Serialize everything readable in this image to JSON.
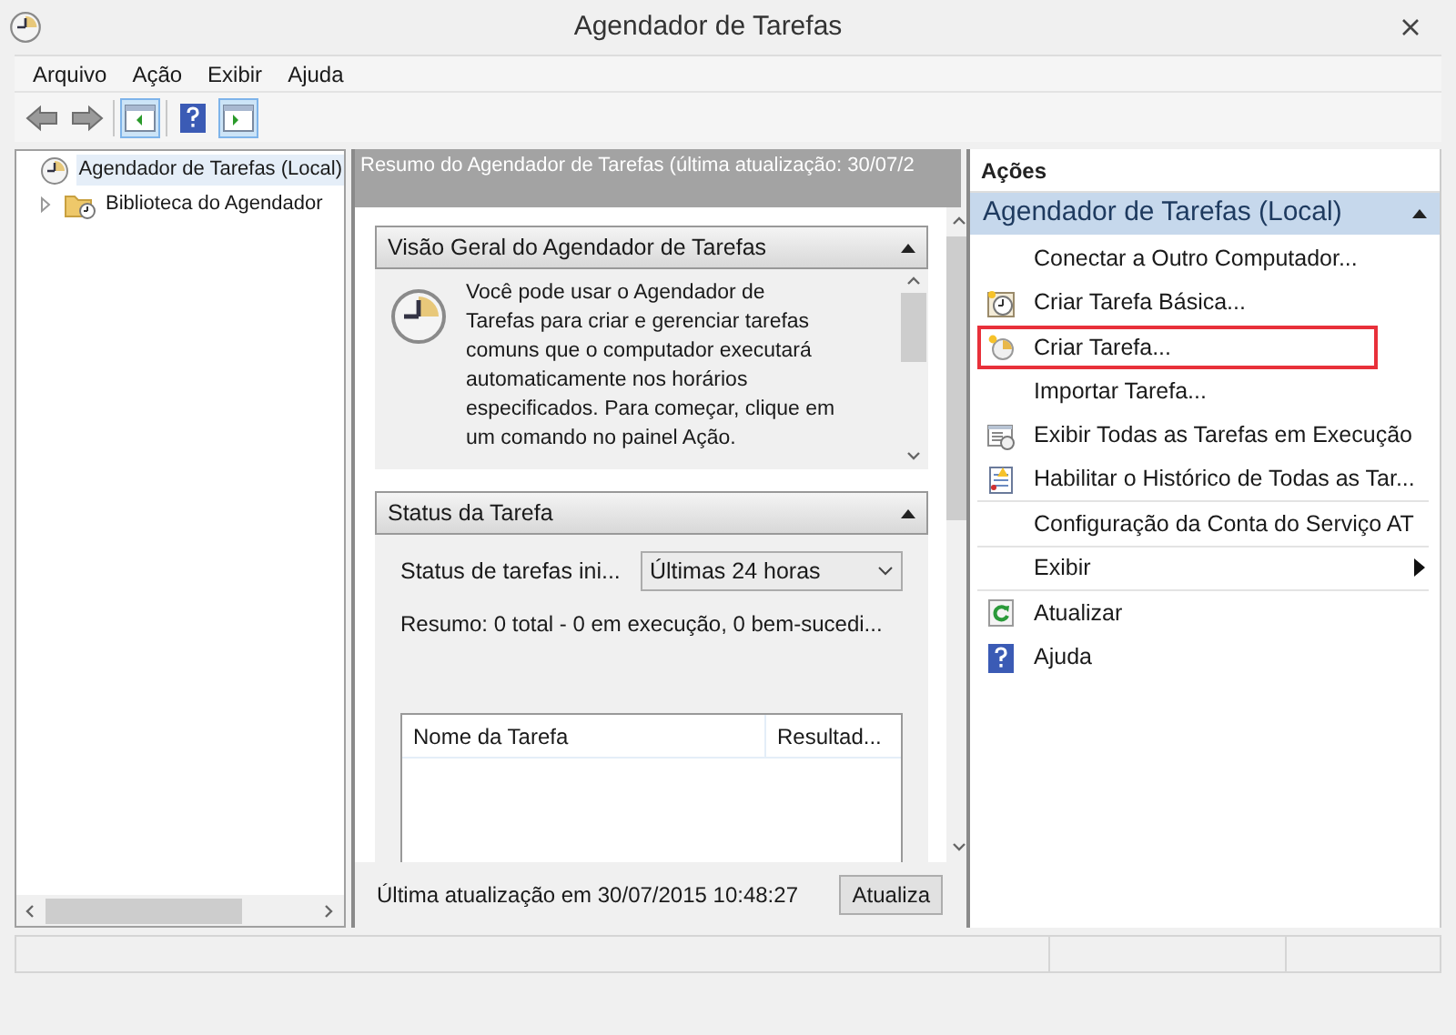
{
  "window": {
    "title": "Agendador de Tarefas"
  },
  "menu": [
    "Arquivo",
    "Ação",
    "Exibir",
    "Ajuda"
  ],
  "toolbar": [
    {
      "kind": "back",
      "selected": false
    },
    {
      "kind": "forward",
      "selected": false
    },
    {
      "kind": "show-tree",
      "selected": true
    },
    {
      "kind": "help",
      "selected": false
    },
    {
      "kind": "show-actions",
      "selected": true
    }
  ],
  "tree": [
    {
      "label": "Agendador de Tarefas (Local)",
      "selected": true,
      "children": [
        {
          "label": "Biblioteca do Agendador",
          "selected": false,
          "expanded": false
        }
      ]
    }
  ],
  "summary": {
    "header": "Resumo do Agendador de Tarefas (última atualização: 30/07/2",
    "overview": {
      "title": "Visão Geral do Agendador de Tarefas",
      "text": "Você pode usar o Agendador de Tarefas para criar e gerenciar tarefas comuns que o computador executará automaticamente nos horários especificados. Para começar, clique em um comando no painel Ação."
    },
    "status": {
      "title": "Status da Tarefa",
      "filter_label": "Status de tarefas ini...",
      "filter_value": "Últimas 24 horas",
      "summary": "Resumo: 0 total - 0 em execução, 0 bem-sucedi...",
      "columns": [
        "Nome da Tarefa",
        "Resultad..."
      ]
    },
    "last_update": "Última atualização em 30/07/2015 10:48:27",
    "refresh_button": "Atualiza"
  },
  "actions": {
    "title": "Ações",
    "group": "Agendador de Tarefas (Local)",
    "items": [
      {
        "label": "Conectar a Outro Computador...",
        "kind": "plain",
        "highlighted": false
      },
      {
        "label": "Criar Tarefa Básica...",
        "kind": "basic-task",
        "highlighted": false
      },
      {
        "label": "Criar Tarefa...",
        "kind": "task",
        "highlighted": true
      },
      {
        "label": "Importar Tarefa...",
        "kind": "plain",
        "highlighted": false
      },
      {
        "label": "Exibir Todas as Tarefas em Execução",
        "kind": "running",
        "highlighted": false
      },
      {
        "label": "Habilitar o Histórico de Todas as Tar...",
        "kind": "history",
        "highlighted": false
      },
      {
        "label": "Configuração da Conta do Serviço AT",
        "kind": "plain",
        "highlighted": false
      },
      {
        "label": "Exibir",
        "kind": "submenu",
        "highlighted": false
      },
      {
        "label": "Atualizar",
        "kind": "refresh",
        "highlighted": false
      },
      {
        "label": "Ajuda",
        "kind": "help",
        "highlighted": false
      }
    ]
  }
}
